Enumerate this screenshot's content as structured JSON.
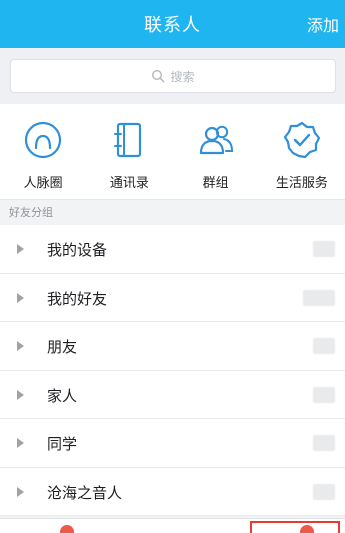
{
  "header": {
    "title": "联系人",
    "add_label": "添加"
  },
  "search": {
    "placeholder": "搜索"
  },
  "shortcuts": [
    {
      "label": "人脉圈",
      "icon": "person-circle-icon"
    },
    {
      "label": "通讯录",
      "icon": "address-book-icon"
    },
    {
      "label": "群组",
      "icon": "group-icon"
    },
    {
      "label": "生活服务",
      "icon": "service-badge-icon"
    }
  ],
  "section": {
    "title": "好友分组"
  },
  "groups": [
    {
      "name": "我的设备"
    },
    {
      "name": "我的好友"
    },
    {
      "name": "朋友"
    },
    {
      "name": "家人"
    },
    {
      "name": "同学"
    },
    {
      "name": "沧海之音人"
    }
  ],
  "colors": {
    "accent": "#1fb5f0",
    "icon_blue": "#2f8fd8",
    "badge_red": "#ee5a4a"
  }
}
